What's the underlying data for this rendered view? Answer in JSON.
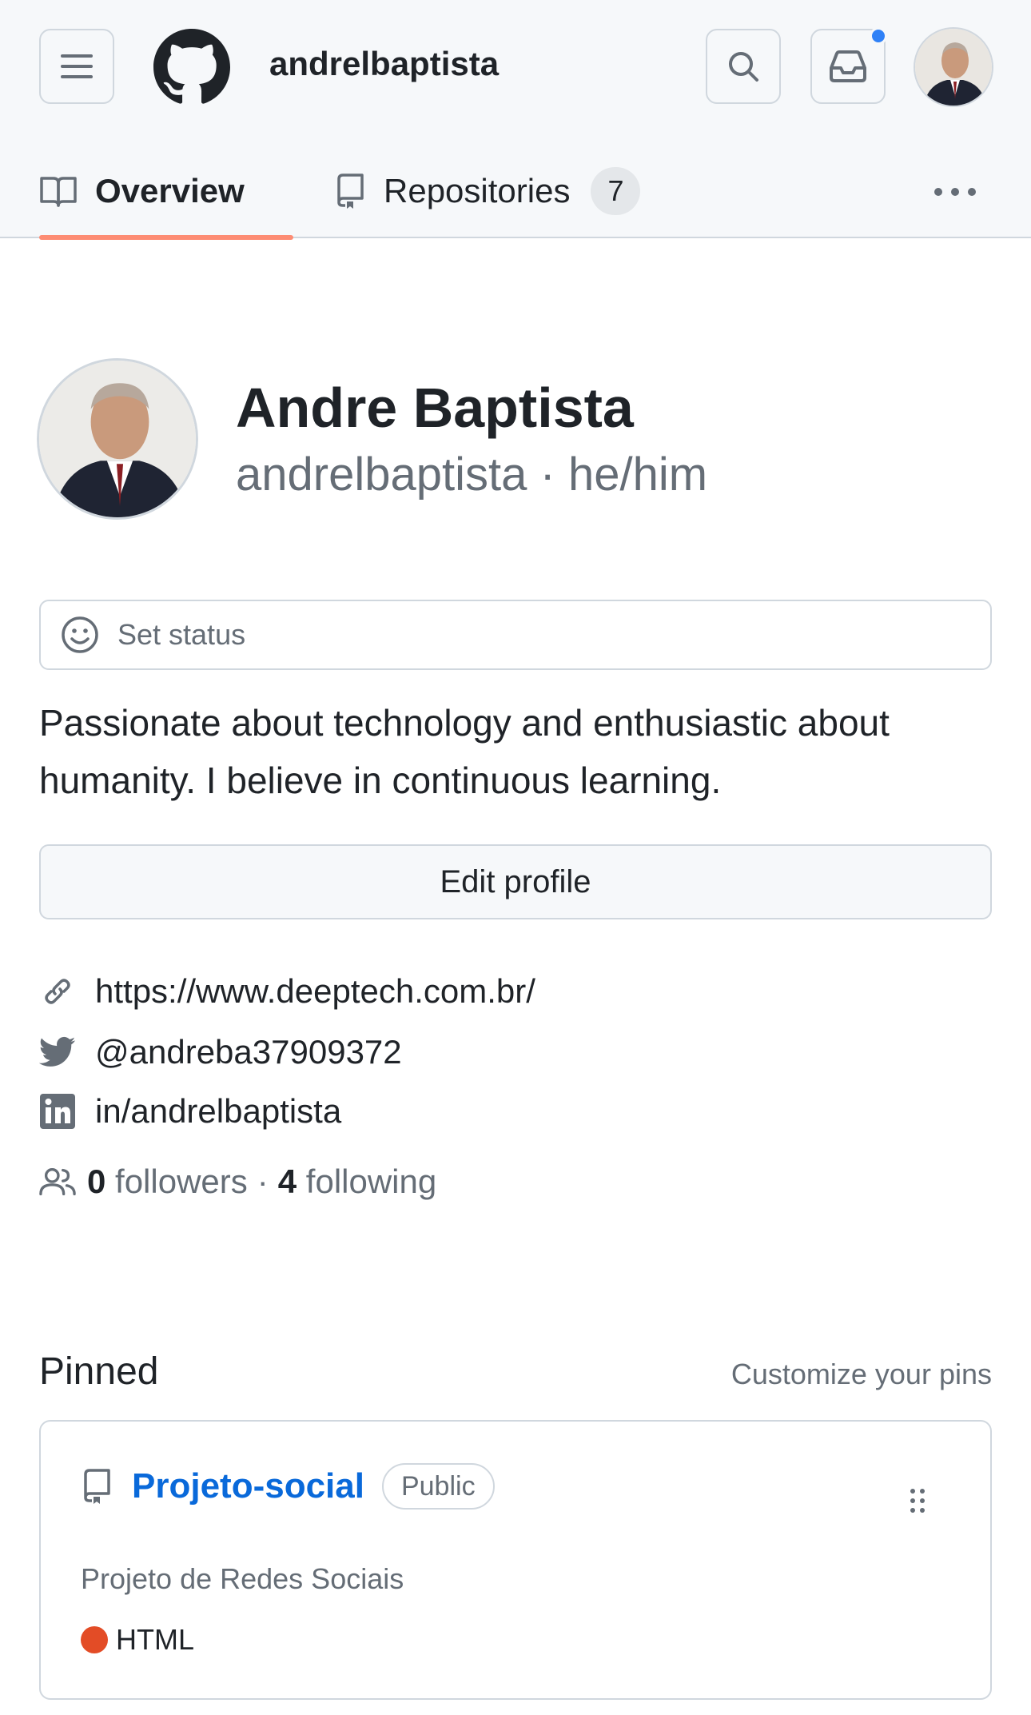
{
  "header": {
    "username": "andrelbaptista",
    "menu_icon": "hamburger-icon",
    "logo_icon": "github-logo",
    "search_icon": "search-icon",
    "inbox_icon": "inbox-icon",
    "notification_color": "#2f81f7"
  },
  "tabs": [
    {
      "label": "Overview",
      "icon": "book-icon",
      "active": true
    },
    {
      "label": "Repositories",
      "icon": "repo-icon",
      "count": "7"
    }
  ],
  "profile": {
    "name": "Andre Baptista",
    "handle": "andrelbaptista",
    "separator": "·",
    "pronouns": "he/him",
    "set_status_label": "Set status",
    "bio": "Passionate about technology and enthusiastic about humanity. I believe in continuous learning.",
    "edit_label": "Edit profile",
    "website": "https://www.deeptech.com.br/",
    "twitter": "@andreba37909372",
    "linkedin": "in/andrelbaptista",
    "followers_count": "0",
    "followers_label": "followers",
    "follow_separator": "·",
    "following_count": "4",
    "following_label": "following"
  },
  "pinned": {
    "title": "Pinned",
    "customize_label": "Customize your pins",
    "items": [
      {
        "name": "Projeto-social",
        "visibility": "Public",
        "description": "Projeto de Redes Sociais",
        "language": "HTML",
        "language_color": "#e34c26"
      }
    ]
  },
  "colors": {
    "accent_underline": "#fd8c73",
    "link": "#0969da"
  }
}
